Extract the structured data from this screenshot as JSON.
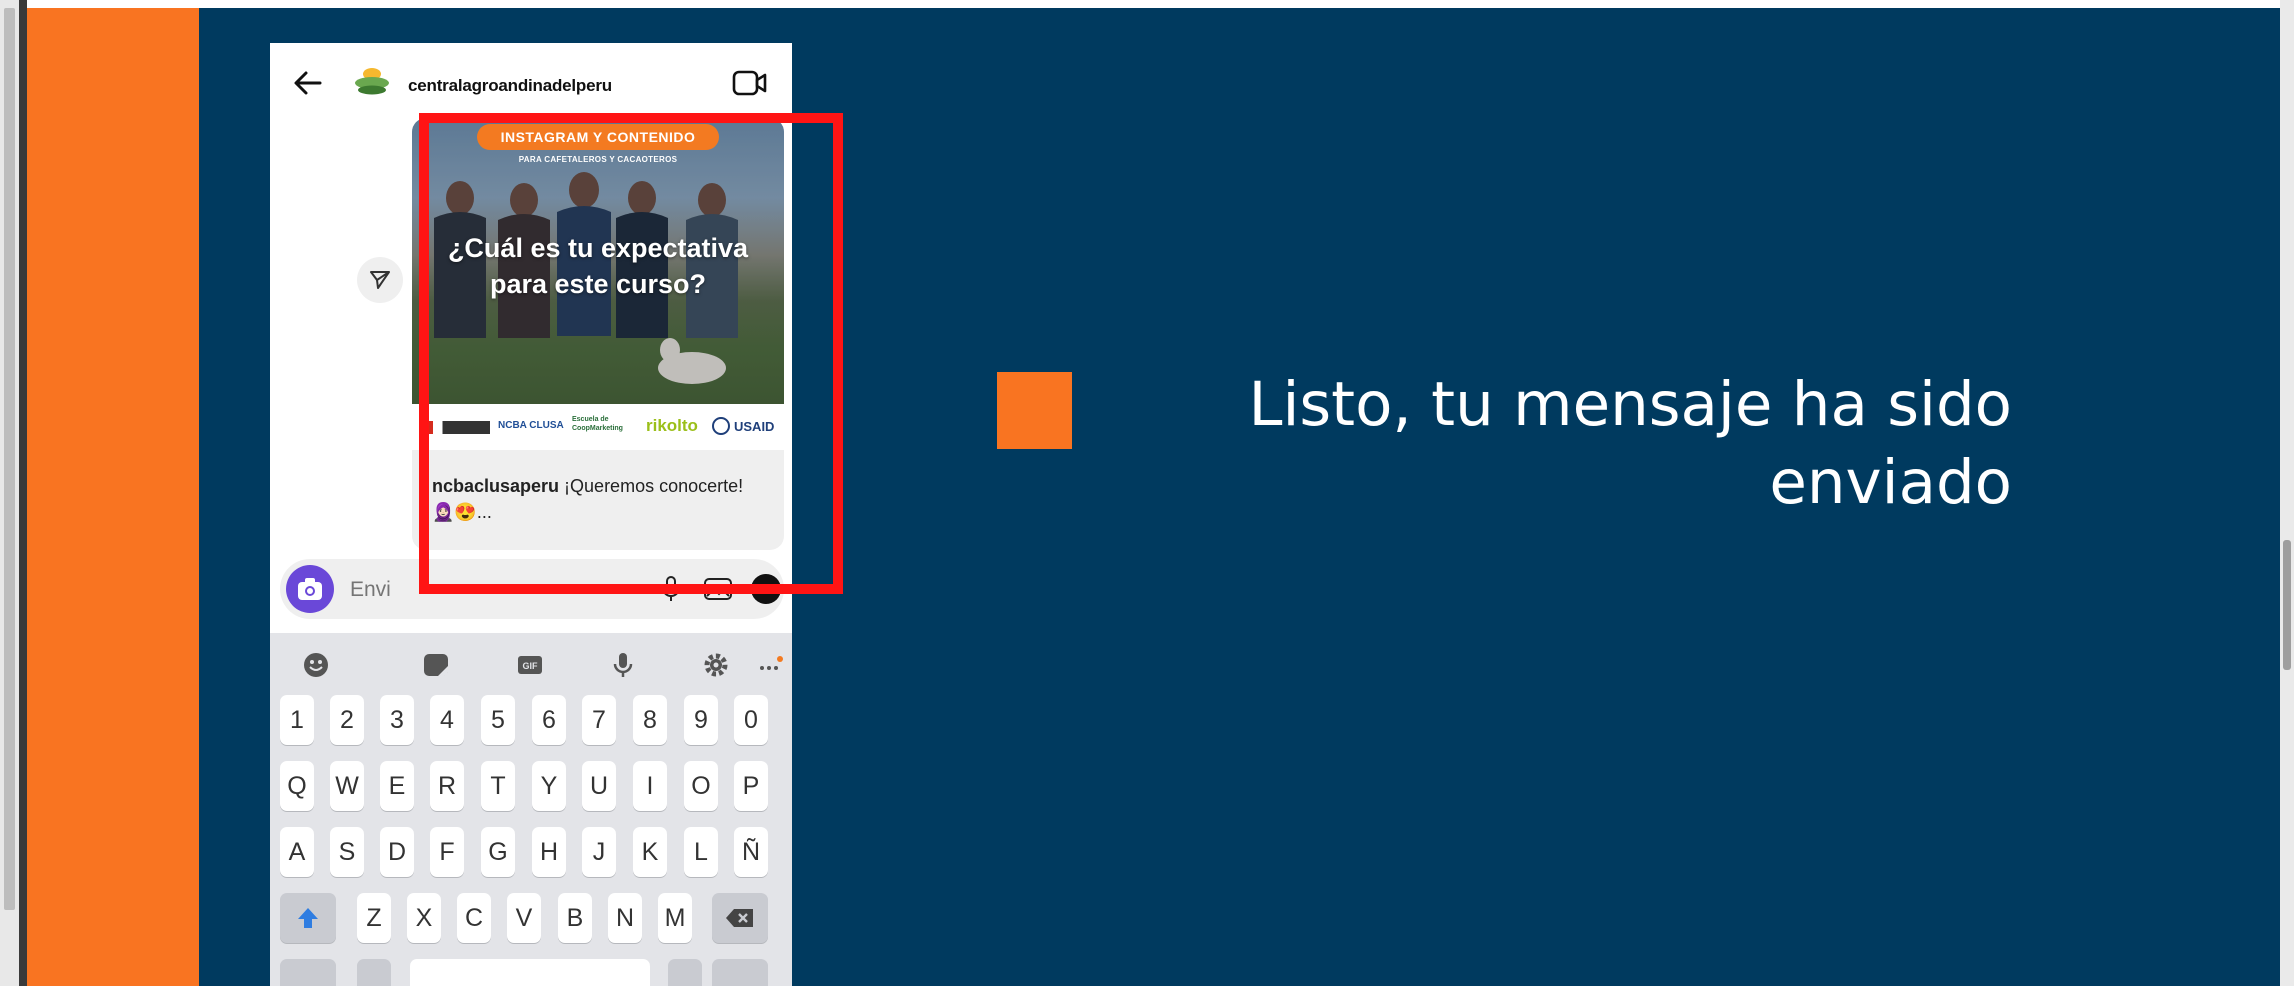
{
  "phone": {
    "username": "centralagroandinadelperu",
    "post": {
      "badge": "INSTAGRAM Y CONTENIDO",
      "subtitle": "PARA CAFETALEROS Y CACAOTEROS",
      "headline_line1": "¿Cuál es tu expectativa",
      "headline_line2": "para este curso?",
      "logo_texts": [
        "NCBA CLUSA",
        "Escuela de CoopMarketing",
        "rikolto",
        "USAID"
      ],
      "caption_user": "ncbaclusaperu",
      "caption_text": " ¡Queremos conocerte!",
      "caption_emoji": "🧕🏻😍..."
    },
    "message_placeholder": "Envi",
    "keyboard": {
      "numbers": [
        "1",
        "2",
        "3",
        "4",
        "5",
        "6",
        "7",
        "8",
        "9",
        "0"
      ],
      "row1": [
        "Q",
        "W",
        "E",
        "R",
        "T",
        "Y",
        "U",
        "I",
        "O",
        "P"
      ],
      "row2": [
        "A",
        "S",
        "D",
        "F",
        "G",
        "H",
        "J",
        "K",
        "L",
        "Ñ"
      ],
      "row3": [
        "Z",
        "X",
        "C",
        "V",
        "B",
        "N",
        "M"
      ]
    }
  },
  "slide": {
    "message_line1": "Listo, tu mensaje ha sido",
    "message_line2": "enviado"
  },
  "colors": {
    "slide_background": "#003A5F",
    "orange": "#F97421",
    "highlight_red": "#FF1414"
  },
  "icons": [
    "back-arrow-icon",
    "video-call-icon",
    "share-icon",
    "camera-icon",
    "microphone-icon",
    "gallery-icon",
    "sticker-icon",
    "emoji-icon",
    "gif-icon",
    "settings-icon",
    "more-icon",
    "shift-icon",
    "backspace-icon"
  ]
}
